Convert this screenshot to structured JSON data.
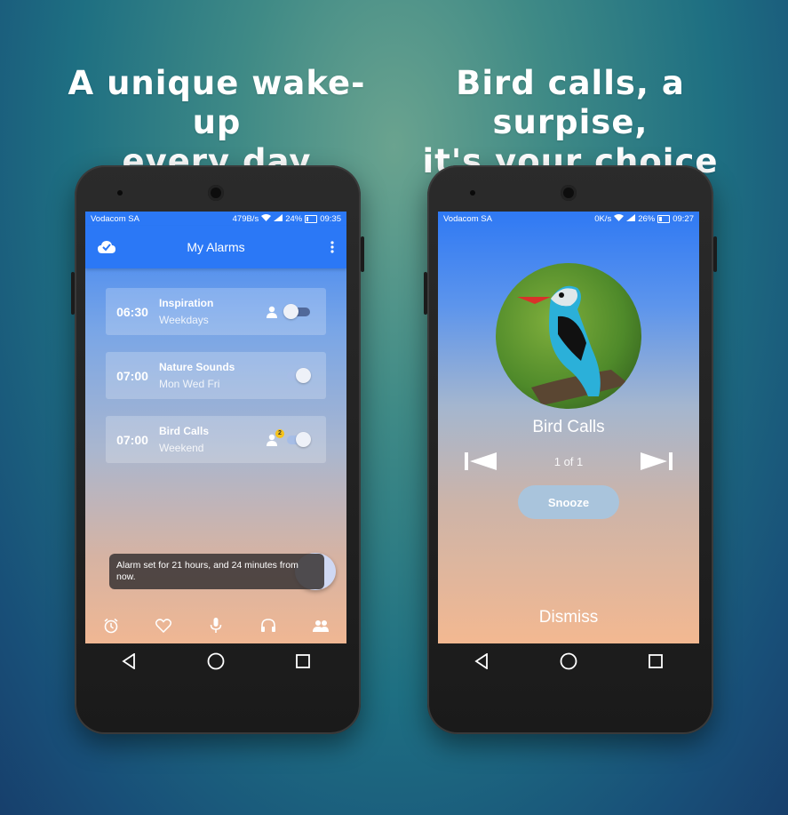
{
  "headlines": {
    "left": {
      "line1": "A unique wake-up",
      "line2": "every day"
    },
    "right": {
      "line1": "Bird calls, a surpise,",
      "line2": "it's your choice"
    }
  },
  "phone_left": {
    "status": {
      "carrier": "Vodacom SA",
      "speed": "479B/s",
      "battery": "24%",
      "time": "09:35",
      "battery_level": 0.24
    },
    "app_title": "My Alarms",
    "alarms": [
      {
        "time": "06:30",
        "name": "Inspiration",
        "days": "Weekdays",
        "enabled": false,
        "extra_icon": "person-icon"
      },
      {
        "time": "07:00",
        "name": "Nature Sounds",
        "days": "Mon Wed Fri",
        "enabled": true,
        "extra_icon": ""
      },
      {
        "time": "07:00",
        "name": "Bird Calls",
        "days": "Weekend",
        "enabled": true,
        "extra_icon": "person-icon",
        "badge": "2"
      }
    ],
    "toast": "Alarm set for 21 hours, and 24 minutes from now.",
    "bottom_nav": [
      "alarm-clock-icon",
      "heart-icon",
      "microphone-icon",
      "headphones-icon",
      "group-icon"
    ]
  },
  "phone_right": {
    "status": {
      "carrier": "Vodacom SA",
      "speed": "0K/s",
      "battery": "26%",
      "time": "09:27",
      "battery_level": 0.26
    },
    "song_title": "Bird Calls",
    "counter": "1 of 1",
    "snooze_label": "Snooze",
    "dismiss_label": "Dismiss"
  },
  "colors": {
    "appbar": "#2b78f6",
    "accent_blue": "#3a82f4",
    "peach": "#f3b891"
  }
}
